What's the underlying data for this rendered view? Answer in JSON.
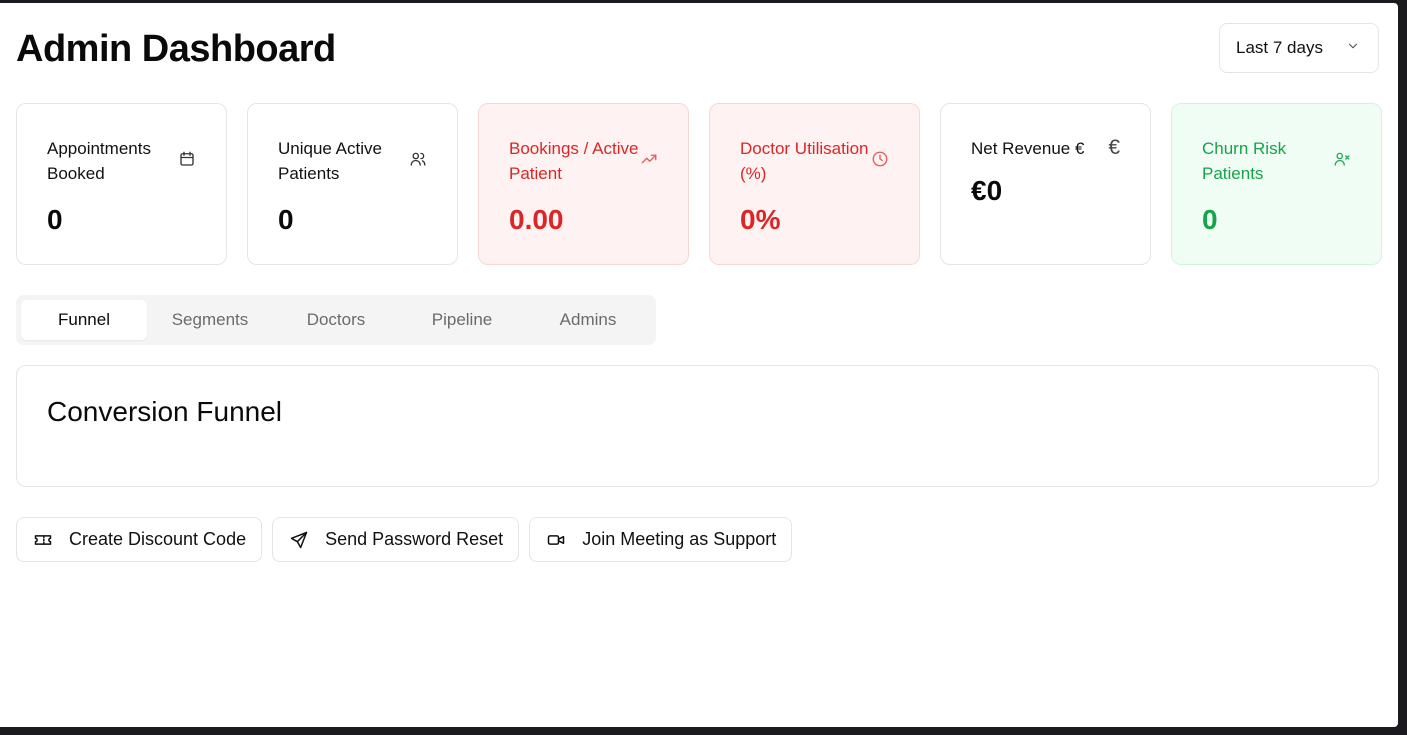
{
  "header": {
    "title": "Admin Dashboard",
    "range_select": {
      "value": "Last 7 days"
    }
  },
  "kpis": [
    {
      "label": "Appointments Booked",
      "value": "0",
      "icon": "calendar-icon",
      "tone": "neutral"
    },
    {
      "label": "Unique Active Patients",
      "value": "0",
      "icon": "users-icon",
      "tone": "neutral"
    },
    {
      "label": "Bookings / Active Patient",
      "value": "0.00",
      "icon": "trending-up-icon",
      "tone": "red"
    },
    {
      "label": "Doctor Utilisation (%)",
      "value": "0%",
      "icon": "clock-icon",
      "tone": "red"
    },
    {
      "label": "Net Revenue €",
      "value": "€0",
      "icon": "euro-icon",
      "icon_glyph": "€",
      "tone": "neutral"
    },
    {
      "label": "Churn Risk Patients",
      "value": "0",
      "icon": "user-x-icon",
      "tone": "green"
    }
  ],
  "tabs": [
    {
      "label": "Funnel",
      "active": true
    },
    {
      "label": "Segments",
      "active": false
    },
    {
      "label": "Doctors",
      "active": false
    },
    {
      "label": "Pipeline",
      "active": false
    },
    {
      "label": "Admins",
      "active": false
    }
  ],
  "funnel": {
    "title": "Conversion Funnel"
  },
  "actions": [
    {
      "label": "Create Discount Code",
      "icon": "ticket-icon"
    },
    {
      "label": "Send Password Reset",
      "icon": "send-icon"
    },
    {
      "label": "Join Meeting as Support",
      "icon": "video-icon"
    }
  ],
  "colors": {
    "red_text": "#dc2626",
    "red_bg": "#fef2f2",
    "green_text": "#16a34a",
    "green_bg": "#f0fdf4",
    "border": "#e5e5e5",
    "tab_bg": "#f4f4f5"
  }
}
